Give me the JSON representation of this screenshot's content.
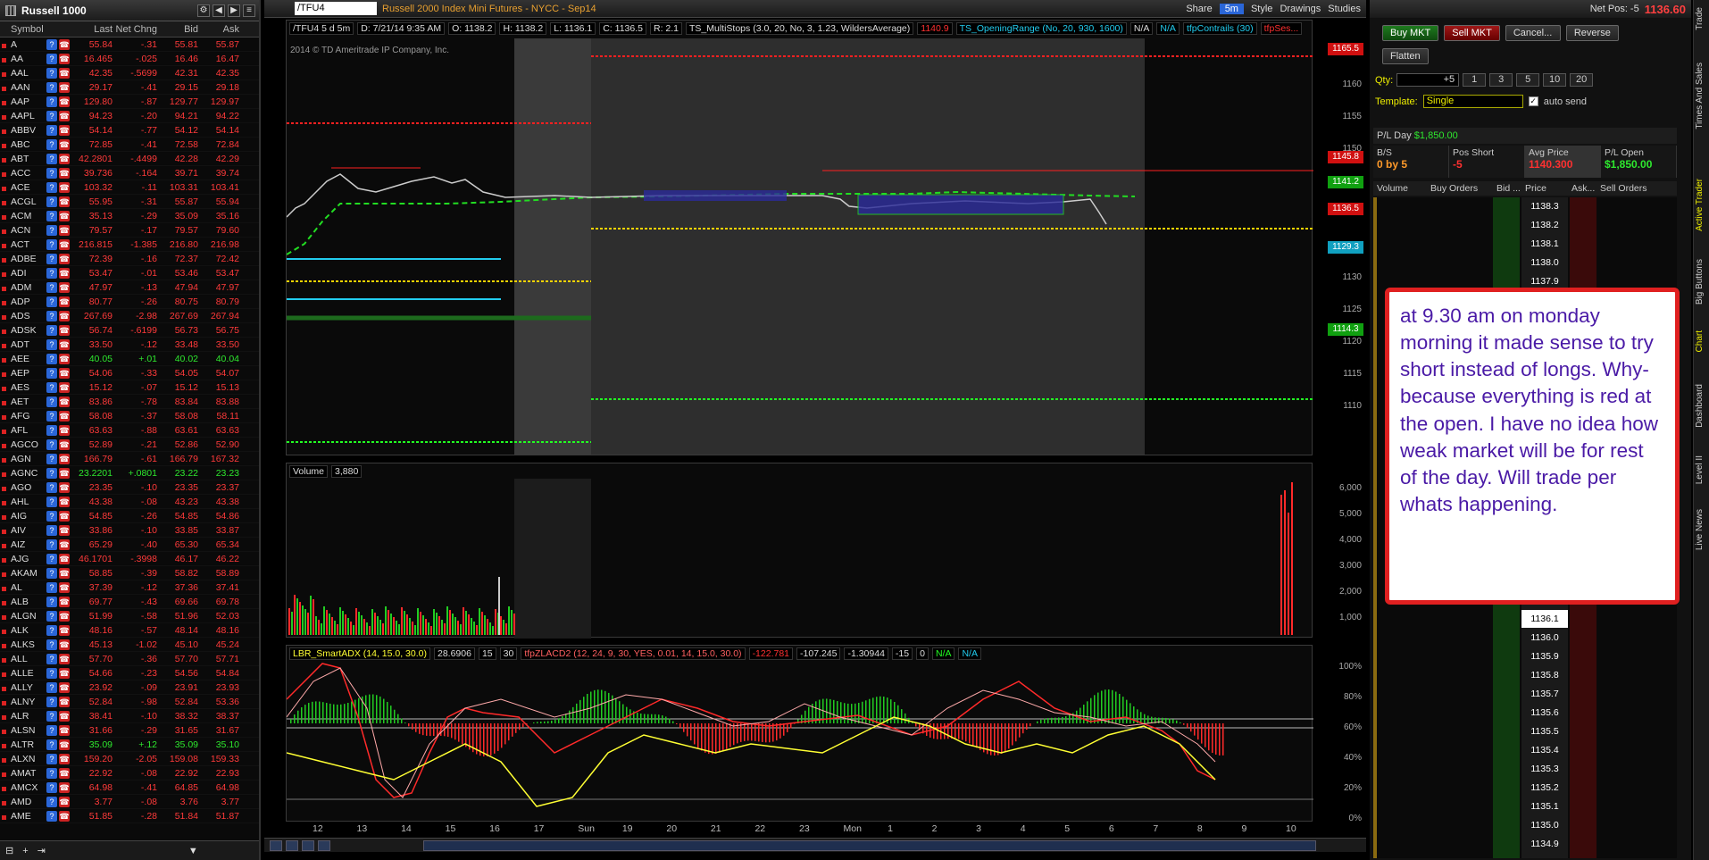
{
  "watchlist": {
    "title": "Russell 1000",
    "columns": [
      "Symbol",
      "Last",
      "Net Chng",
      "Bid",
      "Ask"
    ],
    "rows": [
      {
        "sym": "A",
        "last": "55.84",
        "net": "-.31",
        "bid": "55.81",
        "ask": "55.87",
        "dir": "dn"
      },
      {
        "sym": "AA",
        "last": "16.465",
        "net": "-.025",
        "bid": "16.46",
        "ask": "16.47",
        "dir": "dn"
      },
      {
        "sym": "AAL",
        "last": "42.35",
        "net": "-.5699",
        "bid": "42.31",
        "ask": "42.35",
        "dir": "dn"
      },
      {
        "sym": "AAN",
        "last": "29.17",
        "net": "-.41",
        "bid": "29.15",
        "ask": "29.18",
        "dir": "dn"
      },
      {
        "sym": "AAP",
        "last": "129.80",
        "net": "-.87",
        "bid": "129.77",
        "ask": "129.97",
        "dir": "dn"
      },
      {
        "sym": "AAPL",
        "last": "94.23",
        "net": "-.20",
        "bid": "94.21",
        "ask": "94.22",
        "dir": "dn"
      },
      {
        "sym": "ABBV",
        "last": "54.14",
        "net": "-.77",
        "bid": "54.12",
        "ask": "54.14",
        "dir": "dn"
      },
      {
        "sym": "ABC",
        "last": "72.85",
        "net": "-.41",
        "bid": "72.58",
        "ask": "72.84",
        "dir": "dn"
      },
      {
        "sym": "ABT",
        "last": "42.2801",
        "net": "-.4499",
        "bid": "42.28",
        "ask": "42.29",
        "dir": "dn"
      },
      {
        "sym": "ACC",
        "last": "39.736",
        "net": "-.164",
        "bid": "39.71",
        "ask": "39.74",
        "dir": "dn"
      },
      {
        "sym": "ACE",
        "last": "103.32",
        "net": "-.11",
        "bid": "103.31",
        "ask": "103.41",
        "dir": "dn"
      },
      {
        "sym": "ACGL",
        "last": "55.95",
        "net": "-.31",
        "bid": "55.87",
        "ask": "55.94",
        "dir": "dn"
      },
      {
        "sym": "ACM",
        "last": "35.13",
        "net": "-.29",
        "bid": "35.09",
        "ask": "35.16",
        "dir": "dn"
      },
      {
        "sym": "ACN",
        "last": "79.57",
        "net": "-.17",
        "bid": "79.57",
        "ask": "79.60",
        "dir": "dn"
      },
      {
        "sym": "ACT",
        "last": "216.815",
        "net": "-1.385",
        "bid": "216.80",
        "ask": "216.98",
        "dir": "dn"
      },
      {
        "sym": "ADBE",
        "last": "72.39",
        "net": "-.16",
        "bid": "72.37",
        "ask": "72.42",
        "dir": "dn"
      },
      {
        "sym": "ADI",
        "last": "53.47",
        "net": "-.01",
        "bid": "53.46",
        "ask": "53.47",
        "dir": "dn"
      },
      {
        "sym": "ADM",
        "last": "47.97",
        "net": "-.13",
        "bid": "47.94",
        "ask": "47.97",
        "dir": "dn"
      },
      {
        "sym": "ADP",
        "last": "80.77",
        "net": "-.26",
        "bid": "80.75",
        "ask": "80.79",
        "dir": "dn"
      },
      {
        "sym": "ADS",
        "last": "267.69",
        "net": "-2.98",
        "bid": "267.69",
        "ask": "267.94",
        "dir": "dn"
      },
      {
        "sym": "ADSK",
        "last": "56.74",
        "net": "-.6199",
        "bid": "56.73",
        "ask": "56.75",
        "dir": "dn"
      },
      {
        "sym": "ADT",
        "last": "33.50",
        "net": "-.12",
        "bid": "33.48",
        "ask": "33.50",
        "dir": "dn"
      },
      {
        "sym": "AEE",
        "last": "40.05",
        "net": "+.01",
        "bid": "40.02",
        "ask": "40.04",
        "dir": "up"
      },
      {
        "sym": "AEP",
        "last": "54.06",
        "net": "-.33",
        "bid": "54.05",
        "ask": "54.07",
        "dir": "dn"
      },
      {
        "sym": "AES",
        "last": "15.12",
        "net": "-.07",
        "bid": "15.12",
        "ask": "15.13",
        "dir": "dn"
      },
      {
        "sym": "AET",
        "last": "83.86",
        "net": "-.78",
        "bid": "83.84",
        "ask": "83.88",
        "dir": "dn"
      },
      {
        "sym": "AFG",
        "last": "58.08",
        "net": "-.37",
        "bid": "58.08",
        "ask": "58.11",
        "dir": "dn"
      },
      {
        "sym": "AFL",
        "last": "63.63",
        "net": "-.88",
        "bid": "63.61",
        "ask": "63.63",
        "dir": "dn"
      },
      {
        "sym": "AGCO",
        "last": "52.89",
        "net": "-.21",
        "bid": "52.86",
        "ask": "52.90",
        "dir": "dn"
      },
      {
        "sym": "AGN",
        "last": "166.79",
        "net": "-.61",
        "bid": "166.79",
        "ask": "167.32",
        "dir": "dn"
      },
      {
        "sym": "AGNC",
        "last": "23.2201",
        "net": "+.0801",
        "bid": "23.22",
        "ask": "23.23",
        "dir": "up"
      },
      {
        "sym": "AGO",
        "last": "23.35",
        "net": "-.10",
        "bid": "23.35",
        "ask": "23.37",
        "dir": "dn"
      },
      {
        "sym": "AHL",
        "last": "43.38",
        "net": "-.08",
        "bid": "43.23",
        "ask": "43.38",
        "dir": "dn"
      },
      {
        "sym": "AIG",
        "last": "54.85",
        "net": "-.26",
        "bid": "54.85",
        "ask": "54.86",
        "dir": "dn"
      },
      {
        "sym": "AIV",
        "last": "33.86",
        "net": "-.10",
        "bid": "33.85",
        "ask": "33.87",
        "dir": "dn"
      },
      {
        "sym": "AIZ",
        "last": "65.29",
        "net": "-.40",
        "bid": "65.30",
        "ask": "65.34",
        "dir": "dn"
      },
      {
        "sym": "AJG",
        "last": "46.1701",
        "net": "-.3998",
        "bid": "46.17",
        "ask": "46.22",
        "dir": "dn"
      },
      {
        "sym": "AKAM",
        "last": "58.85",
        "net": "-.39",
        "bid": "58.82",
        "ask": "58.89",
        "dir": "dn"
      },
      {
        "sym": "AL",
        "last": "37.39",
        "net": "-.12",
        "bid": "37.36",
        "ask": "37.41",
        "dir": "dn"
      },
      {
        "sym": "ALB",
        "last": "69.77",
        "net": "-.43",
        "bid": "69.66",
        "ask": "69.78",
        "dir": "dn"
      },
      {
        "sym": "ALGN",
        "last": "51.99",
        "net": "-.58",
        "bid": "51.96",
        "ask": "52.03",
        "dir": "dn"
      },
      {
        "sym": "ALK",
        "last": "48.16",
        "net": "-.57",
        "bid": "48.14",
        "ask": "48.16",
        "dir": "dn"
      },
      {
        "sym": "ALKS",
        "last": "45.13",
        "net": "-1.02",
        "bid": "45.10",
        "ask": "45.24",
        "dir": "dn"
      },
      {
        "sym": "ALL",
        "last": "57.70",
        "net": "-.36",
        "bid": "57.70",
        "ask": "57.71",
        "dir": "dn"
      },
      {
        "sym": "ALLE",
        "last": "54.66",
        "net": "-.23",
        "bid": "54.56",
        "ask": "54.84",
        "dir": "dn"
      },
      {
        "sym": "ALLY",
        "last": "23.92",
        "net": "-.09",
        "bid": "23.91",
        "ask": "23.93",
        "dir": "dn"
      },
      {
        "sym": "ALNY",
        "last": "52.84",
        "net": "-.98",
        "bid": "52.84",
        "ask": "53.36",
        "dir": "dn"
      },
      {
        "sym": "ALR",
        "last": "38.41",
        "net": "-.10",
        "bid": "38.32",
        "ask": "38.37",
        "dir": "dn"
      },
      {
        "sym": "ALSN",
        "last": "31.66",
        "net": "-.29",
        "bid": "31.65",
        "ask": "31.67",
        "dir": "dn"
      },
      {
        "sym": "ALTR",
        "last": "35.09",
        "net": "+.12",
        "bid": "35.09",
        "ask": "35.10",
        "dir": "up"
      },
      {
        "sym": "ALXN",
        "last": "159.20",
        "net": "-2.05",
        "bid": "159.08",
        "ask": "159.33",
        "dir": "dn"
      },
      {
        "sym": "AMAT",
        "last": "22.92",
        "net": "-.08",
        "bid": "22.92",
        "ask": "22.93",
        "dir": "dn"
      },
      {
        "sym": "AMCX",
        "last": "64.98",
        "net": "-.41",
        "bid": "64.85",
        "ask": "64.98",
        "dir": "dn"
      },
      {
        "sym": "AMD",
        "last": "3.77",
        "net": "-.08",
        "bid": "3.76",
        "ask": "3.77",
        "dir": "dn"
      },
      {
        "sym": "AME",
        "last": "51.85",
        "net": "-.28",
        "bid": "51.84",
        "ask": "51.87",
        "dir": "dn"
      }
    ]
  },
  "chart": {
    "symbol": "/TFU4",
    "description": "Russell 2000 Index Mini Futures - NYCC - Sep14",
    "toolbar": [
      "Share",
      "5m",
      "Style",
      "Drawings",
      "Studies"
    ],
    "header": [
      "/TFU4 5 d 5m",
      "D: 7/21/14 9:35 AM",
      "O: 1138.2",
      "H: 1138.2",
      "L: 1136.1",
      "C: 1136.5",
      "R: 2.1",
      "TS_MultiStops (3.0, 20, No, 3, 1.23, WildersAverage)",
      "1140.9",
      "TS_OpeningRange (No, 20, 930, 1600)",
      "N/A",
      "N/A",
      "tfpContrails (30)",
      "tfpSes..."
    ],
    "copyright": "2014 © TD Ameritrade IP Company, Inc.",
    "price_ticks": [
      "1165",
      "1160",
      "1155",
      "1150",
      "1145",
      "1140",
      "1135",
      "1130",
      "1125",
      "1120",
      "1115",
      "1110"
    ],
    "price_tags": [
      {
        "v": "1165.5",
        "c": "#d01010"
      },
      {
        "v": "1145.8",
        "c": "#d01010"
      },
      {
        "v": "1141.2",
        "c": "#10a010"
      },
      {
        "v": "1136.5",
        "c": "#d01010"
      },
      {
        "v": "1129.3",
        "c": "#10a0c0"
      },
      {
        "v": "1114.3",
        "c": "#10a010"
      }
    ],
    "volume": {
      "label": "Volume",
      "value": "3,880",
      "ticks": [
        "6,000",
        "5,000",
        "4,000",
        "3,000",
        "2,000",
        "1,000"
      ]
    },
    "study": {
      "items": [
        "LBR_SmartADX (14, 15.0, 30.0)",
        "28.6906",
        "15",
        "30",
        "tfpZLACD2 (12, 24, 9, 30, YES, 0.01, 14, 15.0, 30.0)",
        "-122.781",
        "-107.245",
        "-1.30944",
        "-15",
        "0",
        "N/A",
        "N/A"
      ],
      "ticks": [
        "100%",
        "80%",
        "60%",
        "40%",
        "20%",
        "0%"
      ]
    },
    "x_labels": [
      "12",
      "13",
      "14",
      "15",
      "16",
      "17",
      "Sun",
      "19",
      "20",
      "21",
      "22",
      "23",
      "Mon",
      "1",
      "2",
      "3",
      "4",
      "5",
      "6",
      "7",
      "8",
      "9",
      "10"
    ]
  },
  "trader": {
    "net_pos_label": "Net Pos: -5",
    "last_price": "1136.60",
    "buy_mkt": "Buy MKT",
    "sell_mkt": "Sell MKT",
    "cancel": "Cancel...",
    "reverse": "Reverse",
    "flatten": "Flatten",
    "qty_label": "Qty:",
    "qty_value": "+5",
    "qty_buttons": [
      "1",
      "3",
      "5",
      "10",
      "20"
    ],
    "template_label": "Template:",
    "template_value": "Single",
    "auto_send": "auto send",
    "pl_day_label": "P/L Day",
    "pl_day_value": "$1,850.00",
    "stats": [
      {
        "label": "B/S",
        "value": "0 by 5",
        "color": "#ff9a2a"
      },
      {
        "label": "Pos Short",
        "value": "-5",
        "color": "#ff3030"
      },
      {
        "label": "Avg Price",
        "value": "1140.300",
        "color": "#ff3030"
      },
      {
        "label": "P/L Open",
        "value": "$1,850.00",
        "color": "#2ee82e"
      }
    ],
    "ladder_cols": [
      "Volume",
      "Buy Orders",
      "Bid ...",
      "Price",
      "Ask...",
      "Sell Orders"
    ],
    "ladder_prices_top": [
      "1138.3",
      "1138.2",
      "1138.1",
      "1138.0",
      "1137.9"
    ],
    "ladder_prices_bottom": [
      "1136.1",
      "1136.0",
      "1135.9",
      "1135.8",
      "1135.7",
      "1135.6",
      "1135.5",
      "1135.4",
      "1135.3",
      "1135.2",
      "1135.1",
      "1135.0",
      "1134.9"
    ]
  },
  "side_tabs": [
    "Trade",
    "Times And Sales",
    "Active Trader",
    "Big Buttons",
    "Chart",
    "Dashboard",
    "Level II",
    "Live News"
  ],
  "annotation": "at 9.30 am on monday morning it made sense to try short instead of longs. Why-  because everything is red at the open. I have no idea how weak market will be for rest of the day. Will trade per whats happening."
}
